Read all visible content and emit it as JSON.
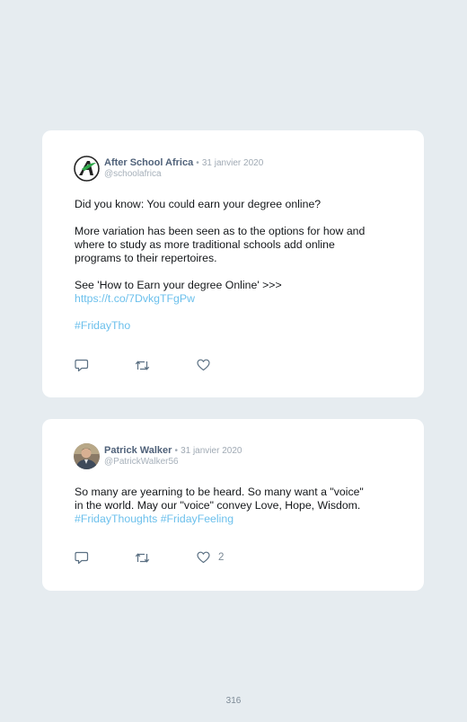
{
  "tweets": [
    {
      "author_name": "After School Africa",
      "separator": "•",
      "date": "31 janvier 2020",
      "handle": "@schoolafrica",
      "text": {
        "line1": "Did you know: You could earn your degree online?",
        "para2_line1": "More variation has been seen as to the options for how and",
        "para2_line2": "where to study as more traditional schools add online",
        "para2_line3": "programs to their repertoires.",
        "para3_line1": "See 'How to Earn your degree Online' >>>",
        "link": "https://t.co/7DvkgTFgPw",
        "hashtag": "#FridayTho"
      },
      "actions": [
        "reply-icon",
        "retweet-icon",
        "like-icon"
      ]
    },
    {
      "author_name": "Patrick Walker",
      "separator": "•",
      "date": "31 janvier 2020",
      "handle": "@PatrickWalker56",
      "text": {
        "line1": "So many are yearning to be heard. So many want a \"voice\"",
        "line2": "in the world. May our \"voice\" convey Love, Hope, Wisdom.",
        "hashtag1": "#FridayThoughts",
        "hashtag2": "#FridayFeeling"
      },
      "like_count": "2",
      "actions": [
        "reply-icon",
        "retweet-icon",
        "like-icon"
      ]
    }
  ],
  "page_number": "316",
  "colors": {
    "background": "#e6ecf0",
    "card": "#ffffff",
    "link": "#6cc0ec",
    "author": "#50627a",
    "muted": "#a0aab4"
  }
}
